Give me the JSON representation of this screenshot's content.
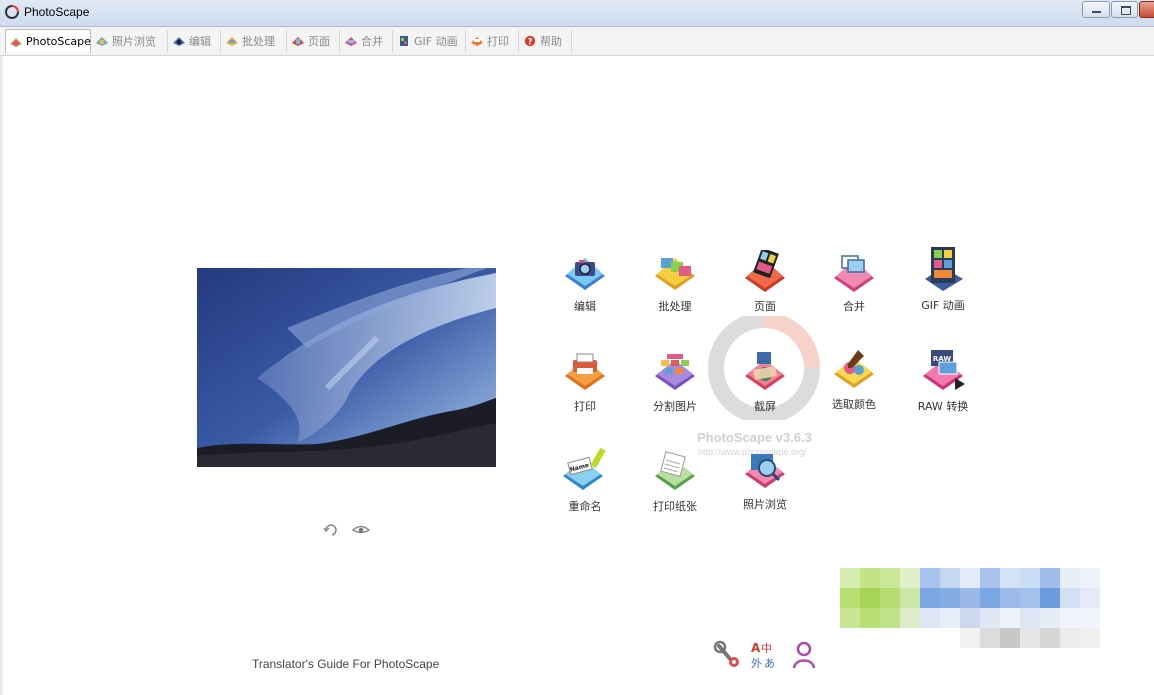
{
  "window": {
    "title": "PhotoScape"
  },
  "tabs": [
    {
      "label": "PhotoScape",
      "icon": "photoscape-icon",
      "active": true
    },
    {
      "label": "照片浏览",
      "icon": "viewer-icon",
      "active": false
    },
    {
      "label": "编辑",
      "icon": "editor-icon",
      "active": false
    },
    {
      "label": "批处理",
      "icon": "batch-icon",
      "active": false
    },
    {
      "label": "页面",
      "icon": "page-icon",
      "active": false
    },
    {
      "label": "合并",
      "icon": "combine-icon",
      "active": false
    },
    {
      "label": "GIF 动画",
      "icon": "gif-icon",
      "active": false
    },
    {
      "label": "打印",
      "icon": "print-icon",
      "active": false
    },
    {
      "label": "帮助",
      "icon": "help-icon",
      "active": false
    }
  ],
  "tools": [
    {
      "label": "编辑",
      "icon": "editor-icon"
    },
    {
      "label": "批处理",
      "icon": "batch-icon"
    },
    {
      "label": "页面",
      "icon": "page-icon"
    },
    {
      "label": "合并",
      "icon": "combine-icon"
    },
    {
      "label": "GIF 动画",
      "icon": "gif-icon"
    },
    {
      "label": "打印",
      "icon": "print-icon"
    },
    {
      "label": "分割图片",
      "icon": "splitter-icon"
    },
    {
      "label": "截屏",
      "icon": "screen-capture-icon"
    },
    {
      "label": "选取颜色",
      "icon": "color-picker-icon"
    },
    {
      "label": "RAW 转换",
      "icon": "raw-converter-icon"
    },
    {
      "label": "重命名",
      "icon": "rename-icon"
    },
    {
      "label": "打印纸张",
      "icon": "paper-print-icon"
    },
    {
      "label": "照片浏览",
      "icon": "viewer-icon"
    }
  ],
  "watermark": {
    "name": "PhotoScape v3.6.3",
    "url": "http://www.photoscape.org/"
  },
  "footer": {
    "translator_link": "Translator's Guide For PhotoScape"
  },
  "colors": {
    "accent": "#2f7fd0",
    "titlebar": "#dfe9f5",
    "close": "#c74a33"
  }
}
